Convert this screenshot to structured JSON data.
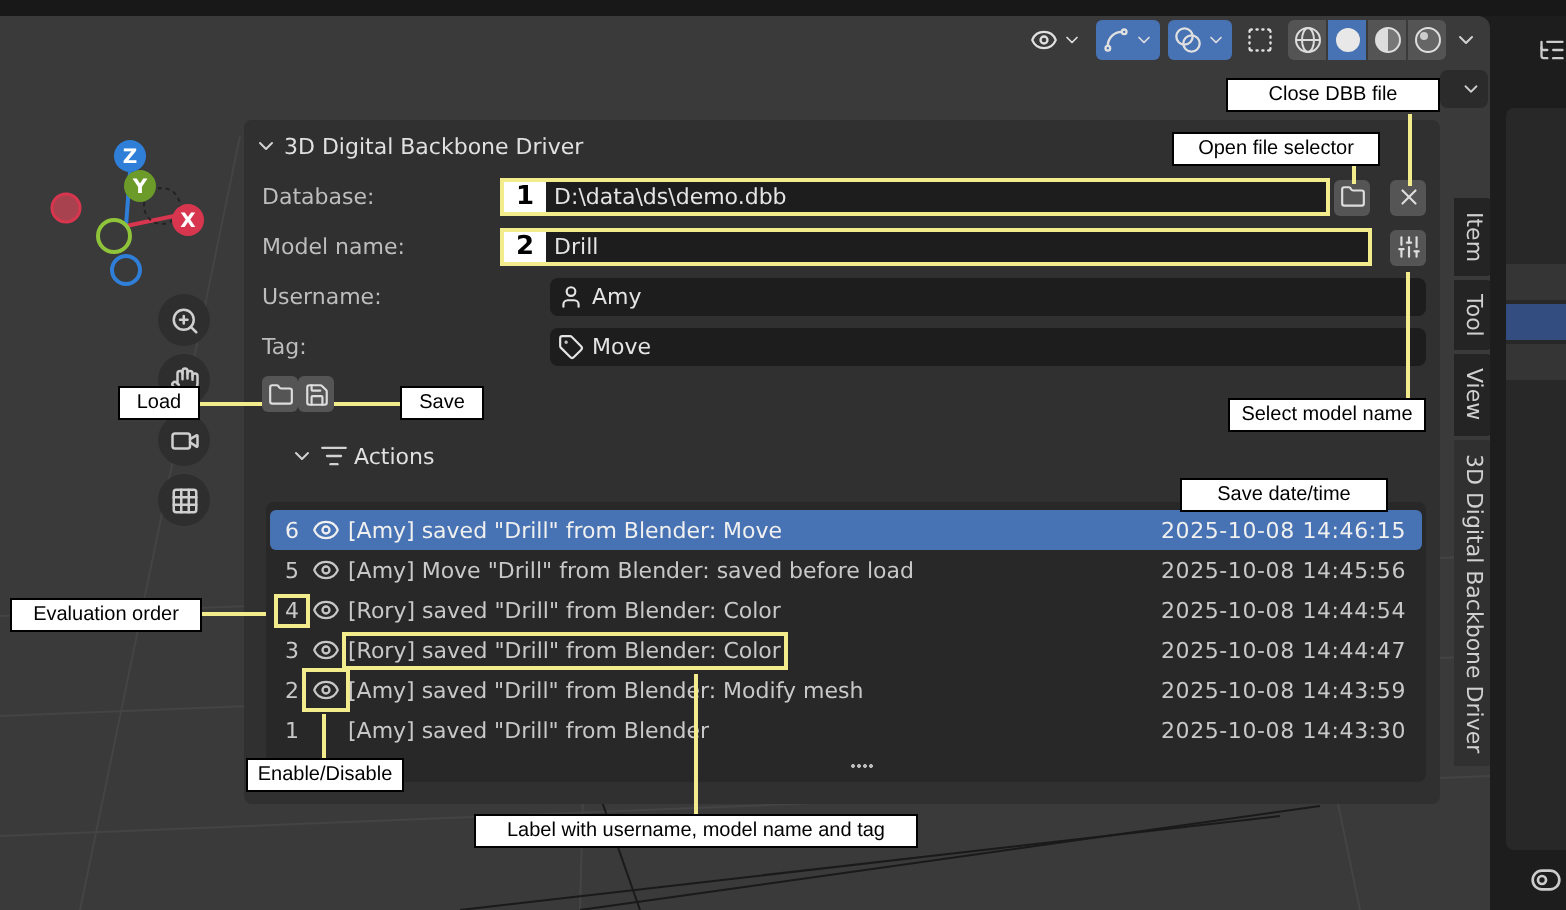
{
  "viewport_header": {
    "toggles": [
      {
        "kind": "visibility",
        "active": false
      },
      {
        "kind": "gizmo",
        "active": true
      },
      {
        "kind": "overlay",
        "active": true
      },
      {
        "kind": "xray",
        "active": false
      }
    ],
    "shading": [
      {
        "kind": "wireframe",
        "selected": false
      },
      {
        "kind": "solid",
        "selected": true
      },
      {
        "kind": "material",
        "selected": false
      },
      {
        "kind": "rendered",
        "selected": false
      }
    ]
  },
  "side_tabs": [
    {
      "label": "Item",
      "selected": false
    },
    {
      "label": "Tool",
      "selected": false
    },
    {
      "label": "View",
      "selected": false
    },
    {
      "label": "3D Digital Backbone Driver",
      "selected": true
    }
  ],
  "panel": {
    "title": "3D Digital Backbone Driver",
    "expanded": true,
    "fields": [
      {
        "kind": "database",
        "label": "Database:",
        "badge": "1",
        "value": "D:\\data\\ds\\demo.dbb",
        "highlighted": true
      },
      {
        "kind": "model",
        "label": "Model name:",
        "badge": "2",
        "value": "Drill",
        "highlighted": true
      },
      {
        "kind": "user",
        "label": "Username:",
        "value": "Amy",
        "highlighted": false
      },
      {
        "kind": "tag",
        "label": "Tag:",
        "value": "Move",
        "highlighted": false
      }
    ],
    "actions": {
      "title": "Actions",
      "expanded": true,
      "rows": [
        {
          "order": "6",
          "enabled": true,
          "label": "[Amy] saved \"Drill\" from Blender: Move",
          "time": "2025-10-08 14:46:15",
          "selected": true
        },
        {
          "order": "5",
          "enabled": true,
          "label": "[Amy] Move \"Drill\" from Blender: saved before load",
          "time": "2025-10-08 14:45:56",
          "selected": false
        },
        {
          "order": "4",
          "enabled": true,
          "label": "[Rory] saved \"Drill\" from Blender: Color",
          "time": "2025-10-08 14:44:54",
          "selected": false,
          "order_marked": true
        },
        {
          "order": "3",
          "enabled": true,
          "label": "[Rory] saved \"Drill\" from Blender: Color",
          "time": "2025-10-08 14:44:47",
          "selected": false,
          "label_marked": true
        },
        {
          "order": "2",
          "enabled": true,
          "label": "[Amy] saved \"Drill\" from Blender: Modify mesh",
          "time": "2025-10-08 14:43:59",
          "selected": false,
          "eye_marked": true
        },
        {
          "order": "1",
          "enabled": false,
          "label": "[Amy] saved \"Drill\" from Blender",
          "time": "2025-10-08 14:43:30",
          "selected": false
        }
      ]
    }
  },
  "gizmo": {
    "axes": [
      "X",
      "Y",
      "Z"
    ]
  },
  "outliner": {
    "rows": [
      {
        "selected": false
      },
      {
        "selected": true
      },
      {
        "selected": false
      }
    ]
  },
  "callouts": [
    {
      "text": "Close DBB file"
    },
    {
      "text": "Open file selector"
    },
    {
      "text": "Load"
    },
    {
      "text": "Save"
    },
    {
      "text": "Select model name"
    },
    {
      "text": "Save date/time"
    },
    {
      "text": "Evaluation order"
    },
    {
      "text": "Enable/Disable"
    },
    {
      "text": "Label with username, model name and tag"
    }
  ]
}
